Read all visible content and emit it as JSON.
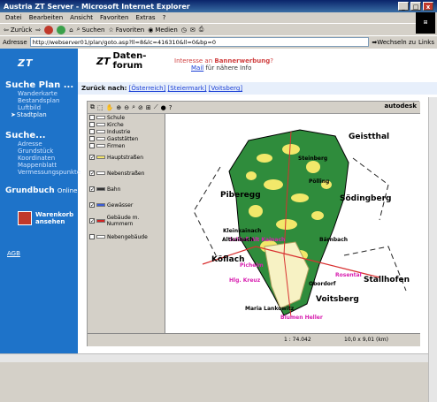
{
  "window": {
    "title": "Austria ZT Server - Microsoft Internet Explorer",
    "controls": [
      "_",
      "□",
      "x"
    ]
  },
  "menu": [
    "Datei",
    "Bearbeiten",
    "Ansicht",
    "Favoriten",
    "Extras",
    "?"
  ],
  "toolbar": {
    "back": "Zurück",
    "search": "Suchen",
    "favorites": "Favoriten",
    "media": "Medien"
  },
  "address": {
    "label": "Adresse",
    "url": "http://webserver01/plan/goto.asp?ll=8&lc=416310&ll=0&bp=0",
    "go": "Wechseln zu",
    "links": "Links"
  },
  "sidebar": {
    "logo": "ZT",
    "suche_plan": "Suche Plan ...",
    "plan_items": [
      "Wanderkarte",
      "Bestandsplan",
      "Luftbild",
      "Stadtplan"
    ],
    "suche": "Suche...",
    "suche_items": [
      "Adresse",
      "Grundstück",
      "Koordinaten",
      "Mappenblatt",
      "Vermessungspunkte"
    ],
    "grundbuch": "Grundbuch",
    "grundbuch_suffix": "Online",
    "warenkorb_line1": "Warenkorb",
    "warenkorb_line2": "ansehen",
    "agb": "AGB"
  },
  "header": {
    "logo_zt": "ZT",
    "logo_forum": "Daten-forum",
    "promo_text": "Interesse an",
    "promo_bold": "Bannerwerbung",
    "promo_end": "?",
    "mail_link": "Mail",
    "mail_rest": "für nähere Info"
  },
  "nav": {
    "label": "Zurück nach:",
    "links": [
      "[Österreich]",
      "[Steiermark]",
      "[Voitsberg]"
    ]
  },
  "map_app": {
    "brand": "autodesk",
    "layers": [
      {
        "label": "Schule",
        "checked": false,
        "color": "#ffffff"
      },
      {
        "label": "Kirche",
        "checked": false,
        "color": "#ffffff"
      },
      {
        "label": "Industrie",
        "checked": false,
        "color": "#ffffff"
      },
      {
        "label": "Gaststätten",
        "checked": false,
        "color": "#ffffff"
      },
      {
        "label": "Firmen",
        "checked": false,
        "color": "#ffffff"
      },
      {
        "label": "Hauptstraßen",
        "checked": true,
        "color": "#f5e66b"
      },
      {
        "label": "Nebenstraßen",
        "checked": true,
        "color": "#ffffff"
      },
      {
        "label": "Bahn",
        "checked": true,
        "color": "#333333"
      },
      {
        "label": "Gewässer",
        "checked": true,
        "color": "#3a5cd6"
      },
      {
        "label": "Gebäude m. Nummern",
        "checked": true,
        "color": "#d22222"
      },
      {
        "label": "Nebengebäude",
        "checked": false,
        "color": "#ffffff"
      }
    ],
    "status_coords": "1 : 74.042",
    "status_scale": "10,0 x 9,01 (km)",
    "places": [
      "Geistthal",
      "Piberegg",
      "Södingberg",
      "Kleinkainach",
      "Schloß Alt Kainach",
      "Köflach",
      "Voitsberg",
      "Stallhofen",
      "Pichelm",
      "Hlg. Kreuz",
      "Obordorf",
      "Maria Lankowitz",
      "Rosental",
      "Blumen Heller",
      "Bärnbach",
      "Altkainach",
      "Steinberg",
      "Pölling"
    ]
  }
}
